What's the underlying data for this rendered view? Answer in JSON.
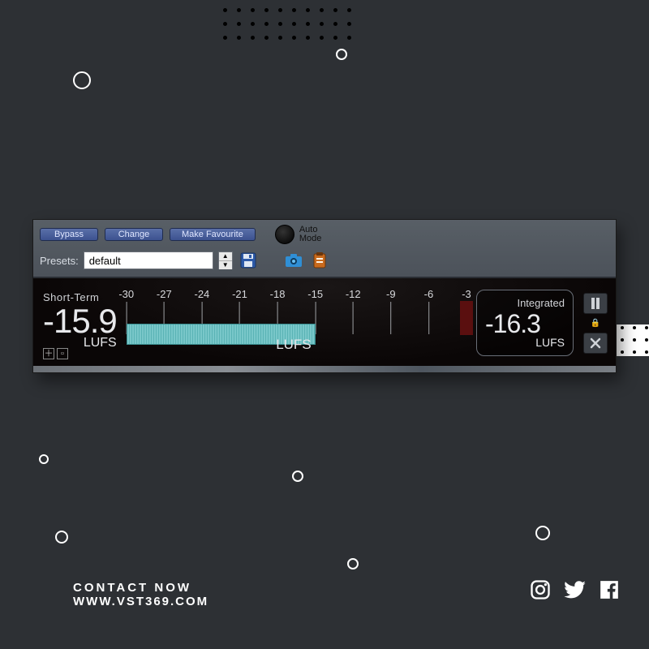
{
  "toolbar": {
    "bypass": "Bypass",
    "change": "Change",
    "make_favourite": "Make Favourite",
    "auto_mode_l1": "Auto",
    "auto_mode_l2": "Mode"
  },
  "presets": {
    "label": "Presets:",
    "value": "default"
  },
  "meter": {
    "short_term_label": "Short-Term",
    "short_term_value": "-15.9",
    "unit": "LUFS",
    "integrated_label": "Integrated",
    "integrated_value": "-16.3",
    "scale_min": -30,
    "scale_max": -3,
    "ticks": [
      "-30",
      "-27",
      "-24",
      "-21",
      "-18",
      "-15",
      "-12",
      "-9",
      "-6",
      "-3"
    ],
    "fill_to_value": -15
  },
  "footer": {
    "line1": "CONTACT NOW",
    "line2": "WWW.VST369.COM"
  }
}
